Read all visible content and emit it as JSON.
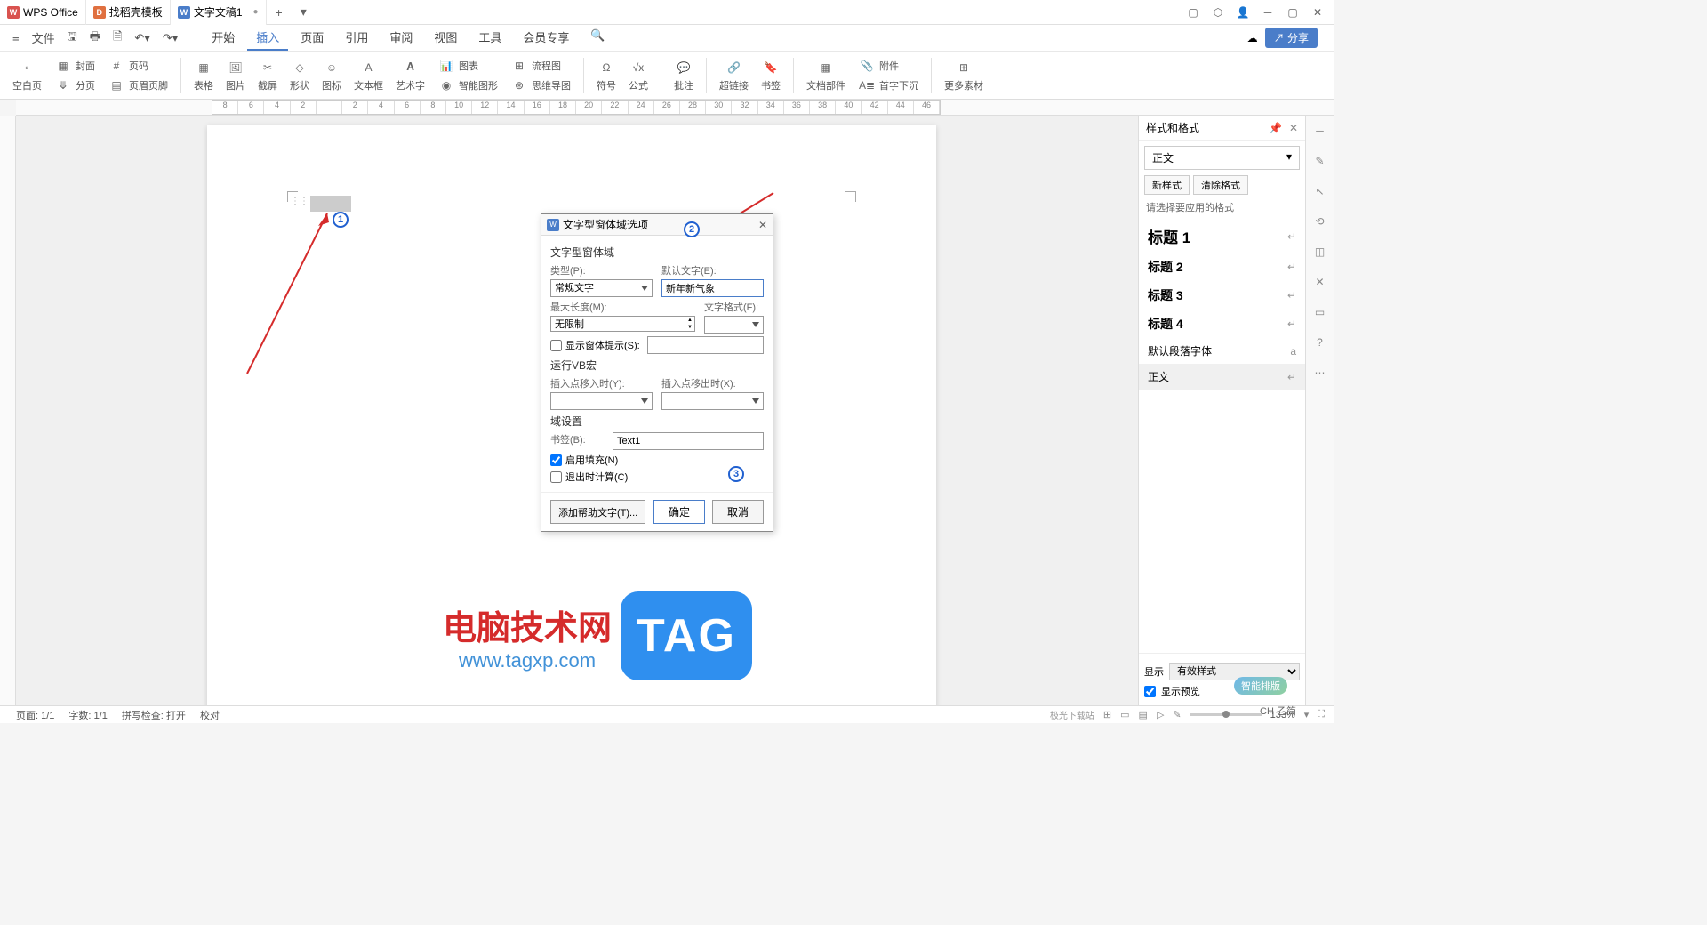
{
  "tabs": {
    "wps": "WPS Office",
    "template": "找稻壳模板",
    "doc": "文字文稿1"
  },
  "menu": {
    "file": "文件",
    "start": "开始",
    "insert": "插入",
    "page": "页面",
    "ref": "引用",
    "review": "审阅",
    "view": "视图",
    "tools": "工具",
    "member": "会员专享"
  },
  "ribbon": {
    "blank": "空白页",
    "cover": "封面",
    "pagenum": "页码",
    "split": "分页",
    "header_footer": "页眉页脚",
    "table": "表格",
    "picture": "图片",
    "screenshot": "截屏",
    "shape": "形状",
    "icon": "图标",
    "textbox": "文本框",
    "wordart": "艺术字",
    "chart": "图表",
    "flowchart": "流程图",
    "smartart": "智能图形",
    "mindmap": "思维导图",
    "symbol": "符号",
    "formula": "公式",
    "comment": "批注",
    "hyperlink": "超链接",
    "bookmark": "书签",
    "docparts": "文档部件",
    "attachment": "附件",
    "dropcap": "首字下沉",
    "more": "更多素材"
  },
  "ruler_marks": [
    "8",
    "6",
    "4",
    "2",
    "",
    "2",
    "4",
    "6",
    "8",
    "10",
    "12",
    "14",
    "16",
    "18",
    "20",
    "22",
    "24",
    "26",
    "28",
    "30",
    "32",
    "34",
    "36",
    "38",
    "40",
    "42",
    "44",
    "46"
  ],
  "dialog": {
    "title": "文字型窗体域选项",
    "section1": "文字型窗体域",
    "type_label": "类型(P):",
    "type_value": "常规文字",
    "default_label": "默认文字(E):",
    "default_value": "新年新气象",
    "maxlen_label": "最大长度(M):",
    "maxlen_value": "无限制",
    "format_label": "文字格式(F):",
    "format_value": "",
    "show_prompt": "显示窗体提示(S):",
    "vb_section": "运行VB宏",
    "entry_label": "插入点移入时(Y):",
    "exit_label": "插入点移出时(X):",
    "field_section": "域设置",
    "bookmark_label": "书签(B):",
    "bookmark_value": "Text1",
    "enable_fill": "启用填充(N)",
    "exit_calc": "退出时计算(C)",
    "help_btn": "添加帮助文字(T)...",
    "ok": "确定",
    "cancel": "取消"
  },
  "watermark": {
    "text": "电脑技术网",
    "url": "www.tagxp.com",
    "tag": "TAG",
    "site": "极光下载站"
  },
  "right_panel": {
    "title": "样式和格式",
    "current": "正文",
    "new_style": "新样式",
    "clear": "清除格式",
    "select_label": "请选择要应用的格式",
    "styles": [
      "标题 1",
      "标题 2",
      "标题 3",
      "标题 4"
    ],
    "default_font": "默认段落字体",
    "body": "正文",
    "show_label": "显示",
    "show_value": "有效样式",
    "preview": "显示预览"
  },
  "statusbar": {
    "page": "页面: 1/1",
    "words": "字数: 1/1",
    "spell": "拼写检查: 打开",
    "proof": "校对",
    "zoom": "133%",
    "ime": "CH 乙简"
  },
  "share": "分享"
}
